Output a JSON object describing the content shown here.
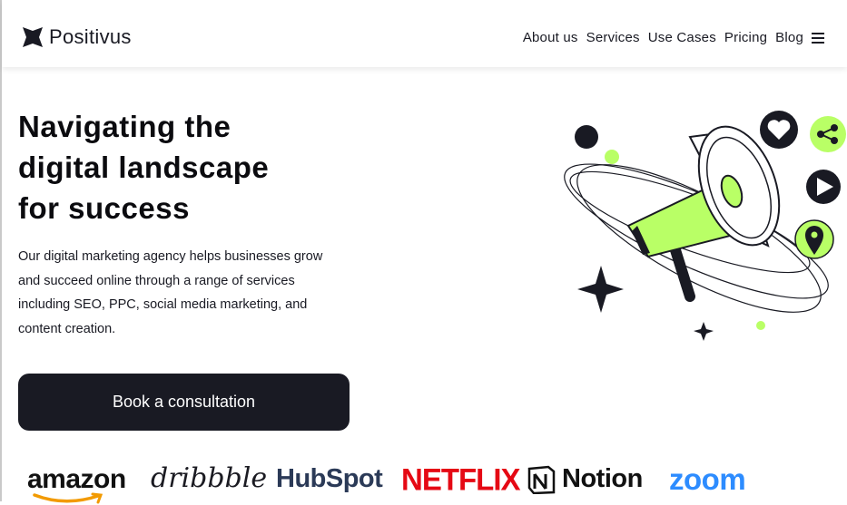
{
  "brand": {
    "name": "Positivus",
    "logo_icon": "sparkle-star-icon"
  },
  "nav": {
    "items": [
      "About us",
      "Services",
      "Use Cases",
      "Pricing",
      "Blog"
    ],
    "menu_icon": "hamburger-menu-icon"
  },
  "hero": {
    "title_lines": [
      "Navigating the",
      "digital landscape",
      "for success"
    ],
    "description": "Our digital marketing agency helps businesses grow and succeed online through a range of services including SEO, PPC, social media marketing, and content creation.",
    "cta_label": "Book a consultation",
    "illustration_icons": [
      "megaphone-icon",
      "heart-icon",
      "share-icon",
      "play-icon",
      "location-pin-icon",
      "sparkle-icon"
    ]
  },
  "logos": {
    "amazon": "amazon",
    "dribbble": "dribbble",
    "hubspot": "HubSpot",
    "netflix": "NETFLIX",
    "notion": "Notion",
    "zoom": "zoom"
  },
  "colors": {
    "accent": "#B9FF66",
    "dark": "#191A23",
    "white": "#FFFFFF"
  }
}
